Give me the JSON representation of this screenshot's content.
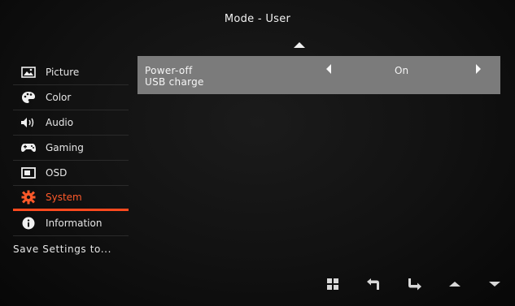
{
  "osd": {
    "title": "Mode - User",
    "menu": [
      {
        "label": "Picture",
        "icon": "picture-icon"
      },
      {
        "label": "Color",
        "icon": "palette-icon"
      },
      {
        "label": "Audio",
        "icon": "speaker-icon"
      },
      {
        "label": "Gaming",
        "icon": "gamepad-icon"
      },
      {
        "label": "OSD",
        "icon": "osd-icon"
      },
      {
        "label": "System",
        "icon": "gear-icon",
        "active": true
      },
      {
        "label": "Information",
        "icon": "info-icon"
      }
    ],
    "save_label": "Save Settings to...",
    "setting": {
      "label_line1": "Power-off",
      "label_line2": "USB charge",
      "value": "On"
    },
    "controls": [
      "grid-icon",
      "back-icon",
      "enter-icon",
      "up-icon",
      "down-icon"
    ],
    "accent_color": "#ff4a1e",
    "highlight_color": "#7b7b7b"
  }
}
